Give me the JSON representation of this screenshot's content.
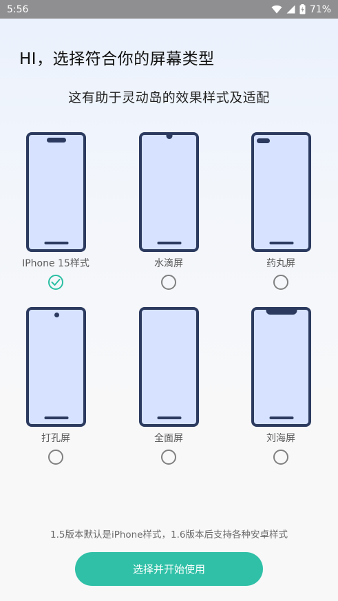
{
  "status_bar": {
    "time": "5:56",
    "battery": "71%",
    "icons": [
      "wifi-icon",
      "signal-icon",
      "battery-charging-icon"
    ]
  },
  "header": {
    "title": "HI，选择符合你的屏幕类型",
    "subtitle": "这有助于灵动岛的效果样式及适配"
  },
  "options": [
    {
      "label": "IPhone 15样式",
      "style": "dynamic-island",
      "selected": true
    },
    {
      "label": "水滴屏",
      "style": "waterdrop",
      "selected": false
    },
    {
      "label": "药丸屏",
      "style": "pill-left",
      "selected": false
    },
    {
      "label": "打孔屏",
      "style": "punch-hole",
      "selected": false
    },
    {
      "label": "全面屏",
      "style": "full-screen",
      "selected": false
    },
    {
      "label": "刘海屏",
      "style": "notch",
      "selected": false
    }
  ],
  "footer": {
    "note": "1.5版本默认是iPhone样式，1.6版本后支持各种安卓样式",
    "button_label": "选择并开始使用"
  },
  "colors": {
    "accent": "#2fc0a7",
    "phone_frame": "#2b3a5e",
    "phone_screen": "#d6e2ff"
  }
}
